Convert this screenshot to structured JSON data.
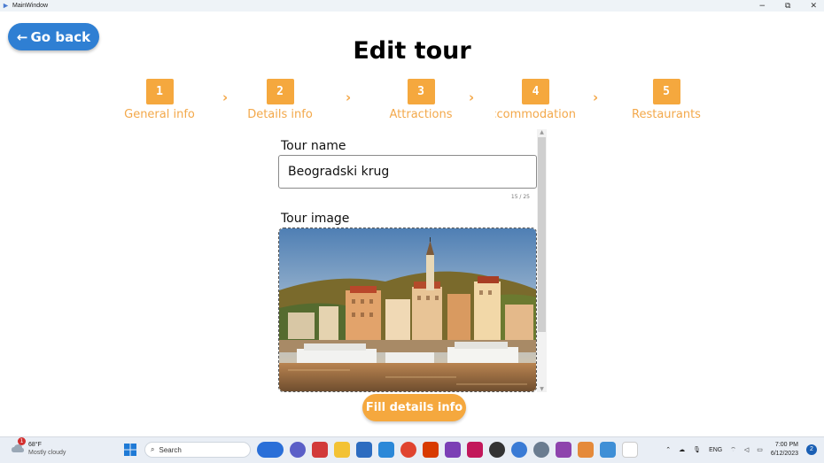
{
  "window": {
    "title": "MainWindow",
    "minimize": "−",
    "restore": "⧉",
    "close": "✕"
  },
  "nav": {
    "go_back": "Go back",
    "back_arrow": "←"
  },
  "page": {
    "title": "Edit tour"
  },
  "steps": [
    {
      "num": "1",
      "label": "General info"
    },
    {
      "num": "2",
      "label": "Details info"
    },
    {
      "num": "3",
      "label": "Attractions"
    },
    {
      "num": "4",
      "label": "Accommodation"
    },
    {
      "num": "5",
      "label": "Restaurants"
    }
  ],
  "chevron": "›",
  "form": {
    "tour_name_label": "Tour name",
    "tour_name_value": "Beogradski krug",
    "tour_name_counter": "15 / 25",
    "tour_image_label": "Tour image"
  },
  "actions": {
    "fill_details": "Fill details info"
  },
  "taskbar": {
    "weather_temp": "68°F",
    "weather_desc": "Mostly cloudy",
    "weather_badge": "1",
    "search_placeholder": "Search",
    "tray_lang": "ENG",
    "clock_time": "7:00 PM",
    "clock_date": "6/12/2023",
    "notification_count": "2"
  },
  "colors": {
    "accent": "#f5a83e",
    "primary": "#2f7fd3"
  }
}
